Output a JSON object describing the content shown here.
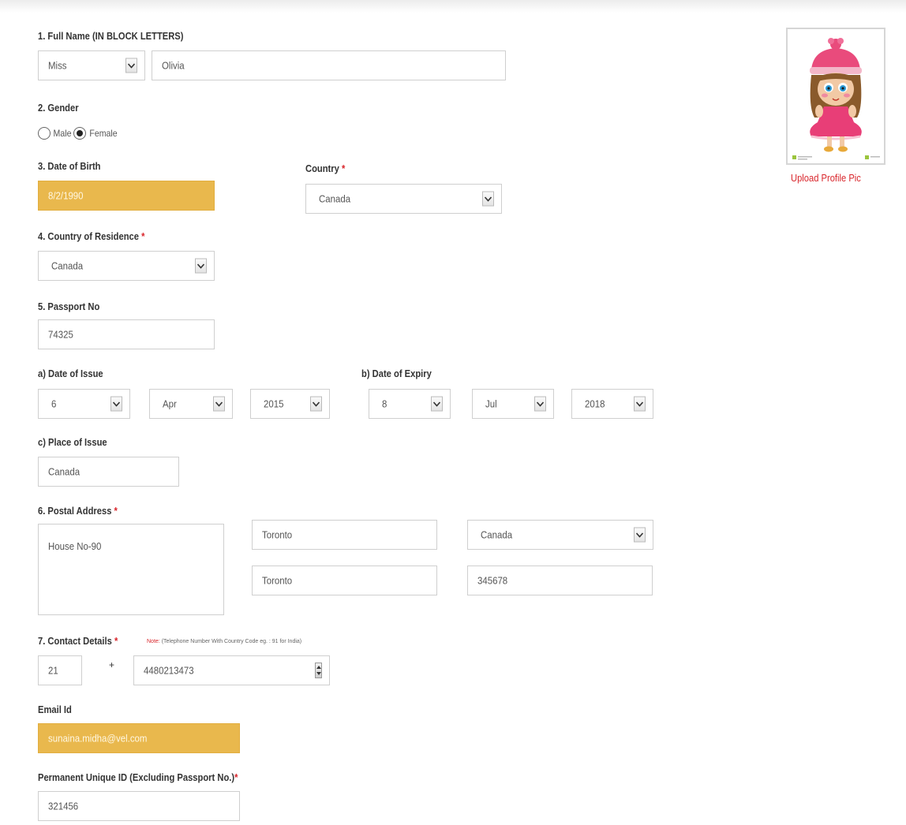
{
  "colors": {
    "accent_red": "#d9252b",
    "filled_field": "#e9b84d"
  },
  "labels": {
    "full_name": "1. Full Name (IN BLOCK LETTERS)",
    "gender": "2. Gender",
    "dob": "3. Date of Birth",
    "country": "Country",
    "country_of_residence": "4. Country of Residence",
    "passport_no": "5. Passport No",
    "date_of_issue": "a) Date of Issue",
    "date_of_expiry": "b) Date of Expiry",
    "place_of_issue": "c) Place of Issue",
    "postal_address": "6. Postal Address",
    "contact_details": "7. Contact Details",
    "email_id": "Email Id",
    "permanent_uid": "Permanent Unique ID (Excluding Passport No.)",
    "required_mark": "*"
  },
  "full_name": {
    "title": "Miss",
    "name": "Olivia"
  },
  "gender": {
    "options": [
      "Male",
      "Female"
    ],
    "selected": "Female"
  },
  "dob": "8/2/1990",
  "country": "Canada",
  "country_of_residence": "Canada",
  "passport_no": "74325",
  "issue": {
    "day": "6",
    "month": "Apr",
    "year": "2015"
  },
  "expiry": {
    "day": "8",
    "month": "Jul",
    "year": "2018"
  },
  "place_of_issue": "Canada",
  "postal": {
    "address": "House No-90",
    "city": "Toronto",
    "country": "Canada",
    "state": "Toronto",
    "zip": "345678"
  },
  "contact": {
    "note_label": "Note:",
    "note_text": "(Telephone Number With Country Code eg. : 91 for India)",
    "country_code": "21",
    "plus": "+",
    "phone": "4480213473"
  },
  "email": "sunaina.midha@vel.com",
  "permanent_uid": "321456",
  "profile": {
    "upload_label": "Upload Profile Pic"
  },
  "icons": {
    "dropdown": "chevron-down-icon",
    "spinner": "spinner-icon",
    "profile": "profile-picture"
  }
}
